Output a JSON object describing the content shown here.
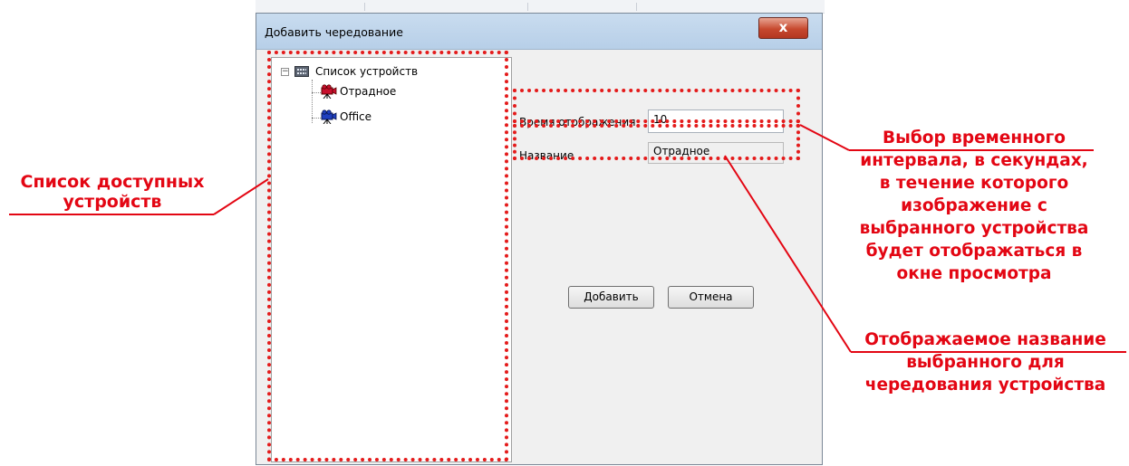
{
  "dialog": {
    "title": "Добавить чередование",
    "close_symbol": "x"
  },
  "tree": {
    "root_label": "Список устройств",
    "root_icon": "device-list-icon",
    "items": [
      {
        "label": "Отрадное",
        "icon": "camera-icon",
        "icon_color": "#c8102e"
      },
      {
        "label": "Office",
        "icon": "camera-icon",
        "icon_color": "#1f3fbf"
      }
    ]
  },
  "form": {
    "display_time_label": "Время отображения",
    "display_time_value": "10",
    "name_label": "Название",
    "name_value": "Отрадное"
  },
  "buttons": {
    "add_label": "Добавить",
    "cancel_label": "Отмена"
  },
  "annotations": {
    "device_list_line1": "Список доступных",
    "device_list_line2": "устройств",
    "interval_lines": [
      "Выбор временного",
      "интервала, в секундах,",
      "в течение которого",
      "изображение с",
      "выбранного устройства",
      "будет отображаться в",
      "окне просмотра"
    ],
    "name_lines": [
      "Отображаемое название",
      "выбранного для",
      "чередования устройства"
    ],
    "color": "#e30613"
  }
}
